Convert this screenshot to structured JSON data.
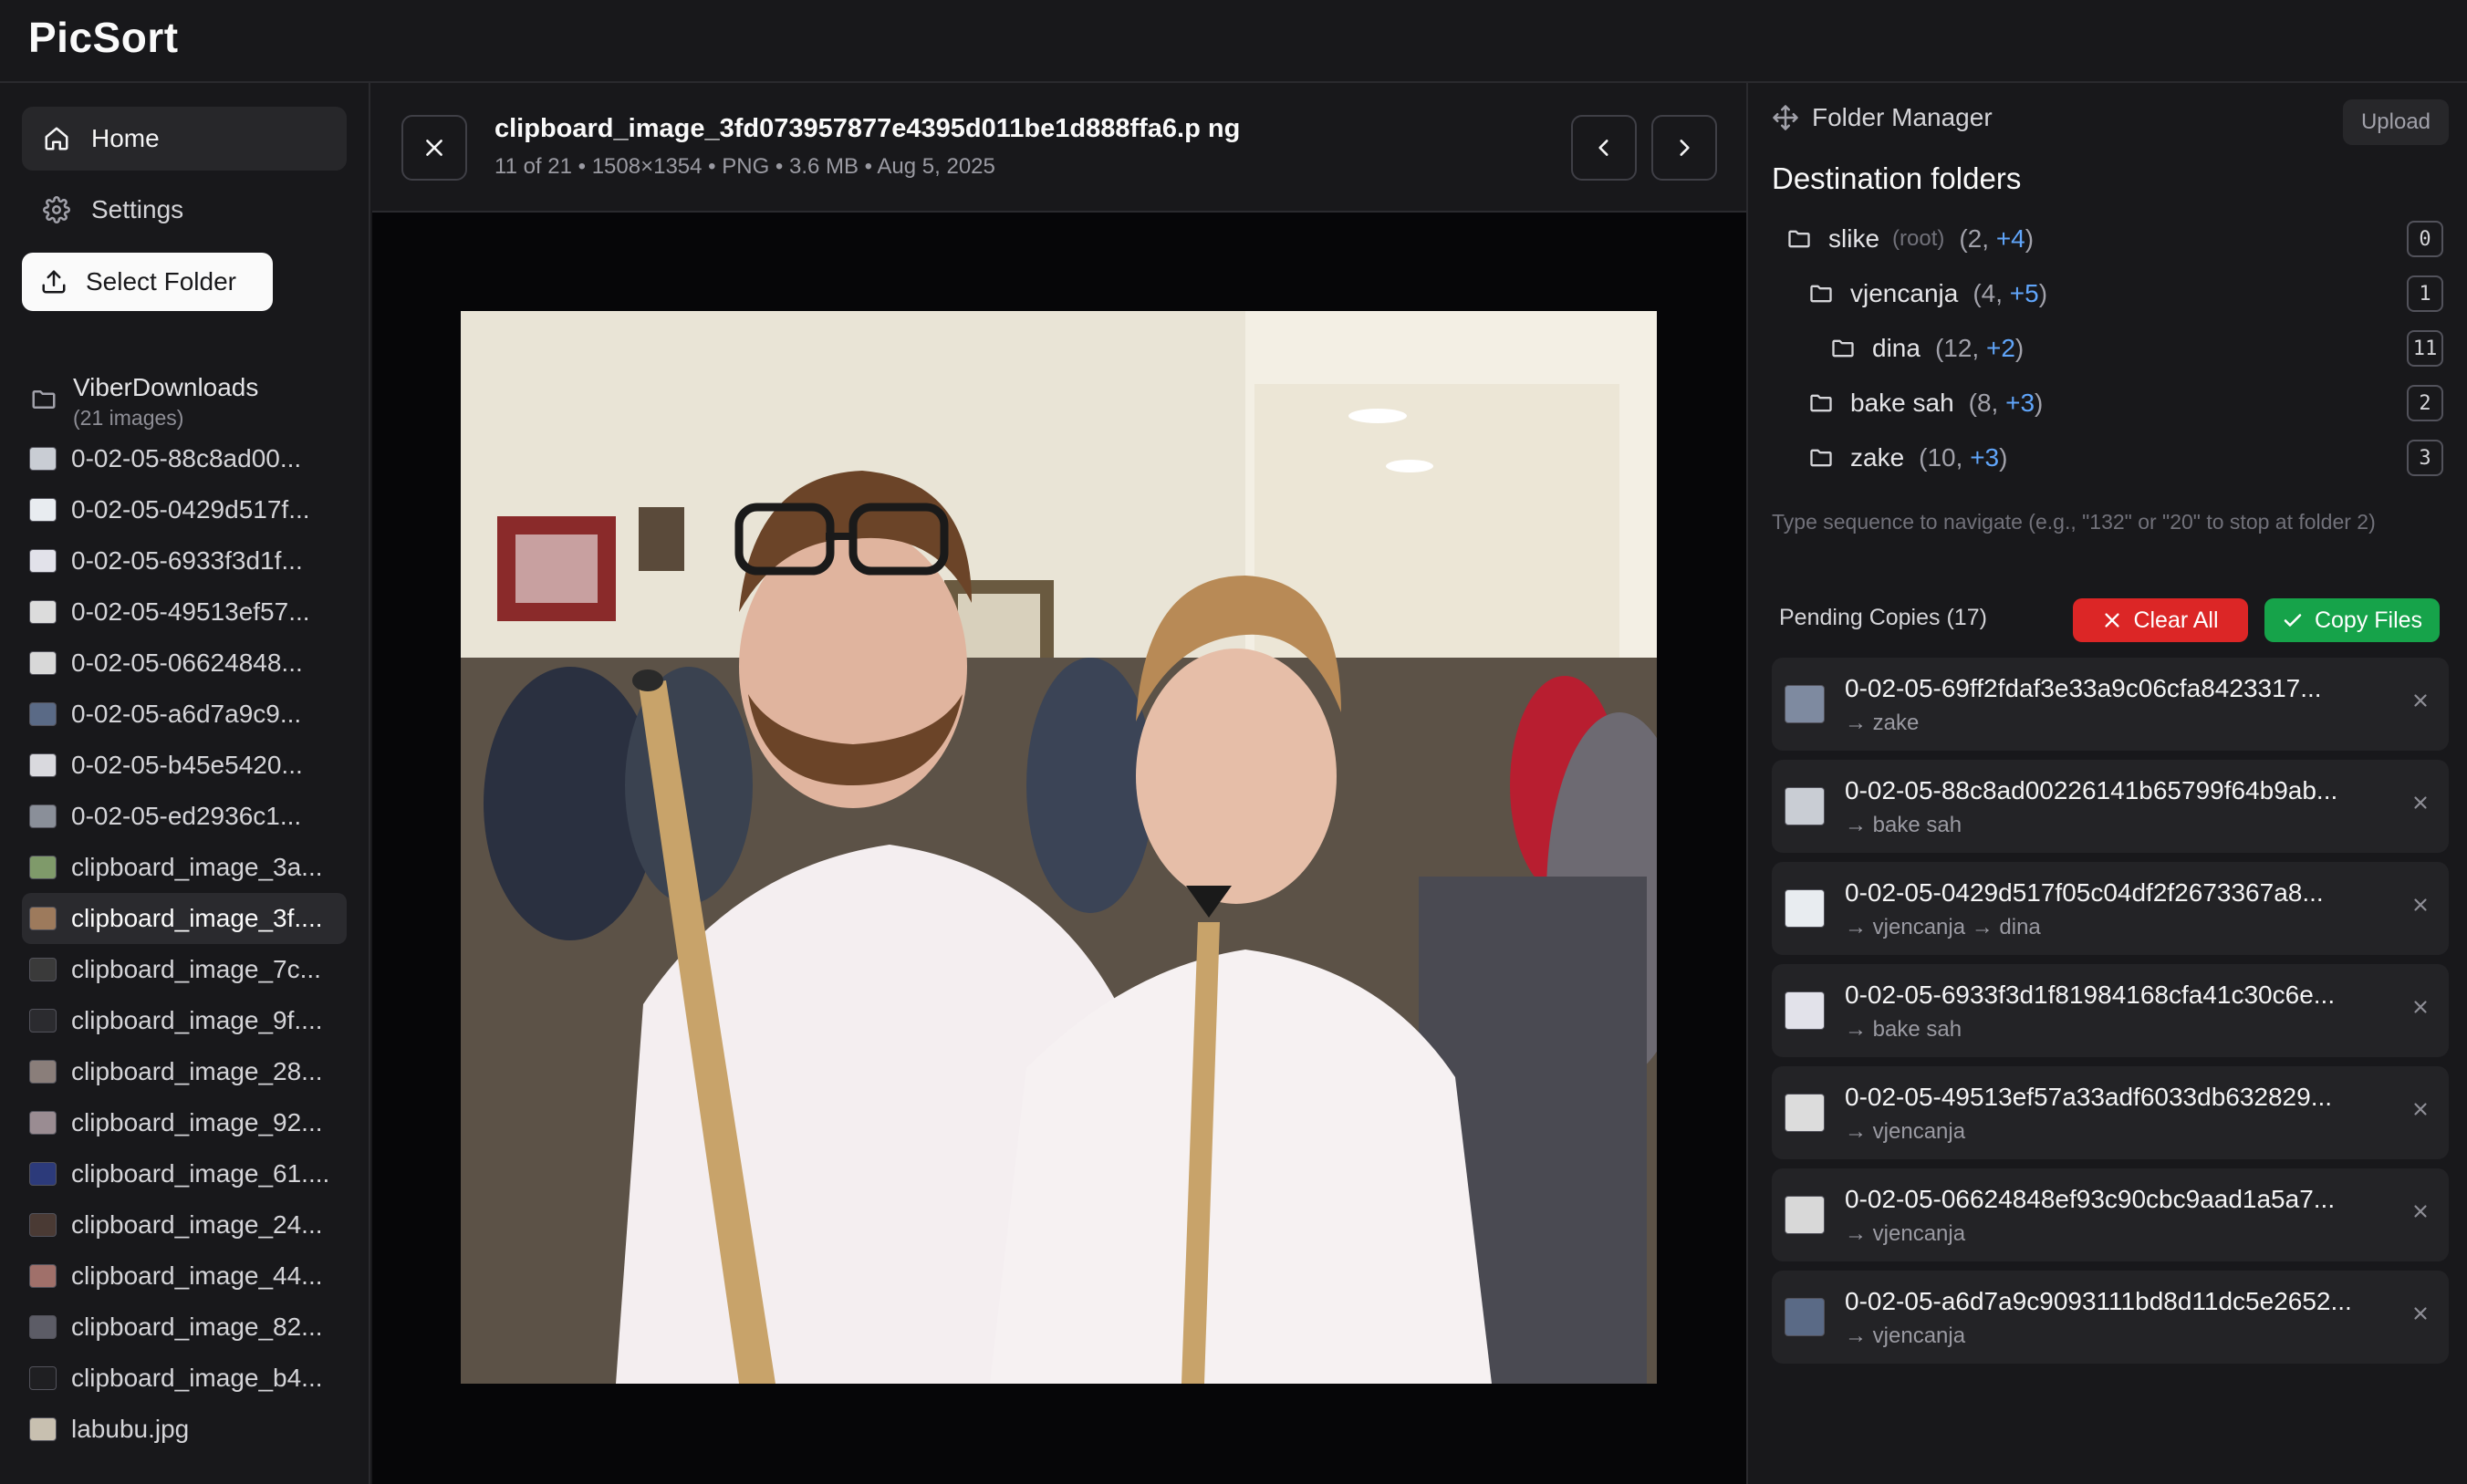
{
  "app": {
    "title": "PicSort"
  },
  "sidebar": {
    "nav": [
      {
        "label": "Home",
        "icon": "home-icon"
      },
      {
        "label": "Settings",
        "icon": "gear-icon"
      },
      {
        "label": "Select Folder",
        "icon": "upload-icon"
      }
    ],
    "folder": {
      "name": "ViberDownloads",
      "count": "(21 images)"
    },
    "files": [
      {
        "name": "0-02-05-88c8ad00...",
        "thumb": "#c9cdd4"
      },
      {
        "name": "0-02-05-0429d517f...",
        "thumb": "#e8ecf0"
      },
      {
        "name": "0-02-05-6933f3d1f...",
        "thumb": "#e2e2ea"
      },
      {
        "name": "0-02-05-49513ef57...",
        "thumb": "#dcdcdc"
      },
      {
        "name": "0-02-05-06624848...",
        "thumb": "#d8d8d8"
      },
      {
        "name": "0-02-05-a6d7a9c9...",
        "thumb": "#5a6a86"
      },
      {
        "name": "0-02-05-b45e5420...",
        "thumb": "#d9d9de"
      },
      {
        "name": "0-02-05-ed2936c1...",
        "thumb": "#8a8f99"
      },
      {
        "name": "clipboard_image_3a...",
        "thumb": "#7f9a6a"
      },
      {
        "name": "clipboard_image_3f....",
        "thumb": "#9d7a5c",
        "active": true
      },
      {
        "name": "clipboard_image_7c...",
        "thumb": "#3a3a3a"
      },
      {
        "name": "clipboard_image_9f....",
        "thumb": "#2b2b2f"
      },
      {
        "name": "clipboard_image_28...",
        "thumb": "#8a7e7a"
      },
      {
        "name": "clipboard_image_92...",
        "thumb": "#9a8c92"
      },
      {
        "name": "clipboard_image_61....",
        "thumb": "#2c3a7a"
      },
      {
        "name": "clipboard_image_24...",
        "thumb": "#4a3a34"
      },
      {
        "name": "clipboard_image_44...",
        "thumb": "#a0706a"
      },
      {
        "name": "clipboard_image_82...",
        "thumb": "#5c5c66"
      },
      {
        "name": "clipboard_image_b4...",
        "thumb": "#1f1f22"
      },
      {
        "name": "labubu.jpg",
        "thumb": "#c8c0b0"
      }
    ]
  },
  "viewer": {
    "title": "clipboard_image_3fd073957877e4395d011be1d888ffa6.p ng",
    "meta": "11 of 21 • 1508×1354 • PNG • 3.6 MB • Aug 5, 2025",
    "photo": "photo of two men in white shirts at an indoor event"
  },
  "panel": {
    "title": "Folder Manager",
    "upload_label": "Upload",
    "dest_title": "Destination folders",
    "tree": [
      {
        "name": "slike",
        "root": "(root)",
        "count": "(2, ",
        "plus": "+4",
        "close": ")",
        "key": "0"
      },
      {
        "name": "vjencanja",
        "count": "(4, ",
        "plus": "+5",
        "close": ")",
        "key": "1"
      },
      {
        "name": "dina",
        "count": "(12, ",
        "plus": "+2",
        "close": ")",
        "key": "11"
      },
      {
        "name": "bake sah",
        "count": "(8, ",
        "plus": "+3",
        "close": ")",
        "key": "2"
      },
      {
        "name": "zake",
        "count": "(10, ",
        "plus": "+3",
        "close": ")",
        "key": "3"
      }
    ],
    "hint": "Type sequence to navigate (e.g., \"132\" or \"20\" to stop at folder 2)",
    "pending_title": "Pending Copies (17)",
    "clear_label": "Clear All",
    "copy_label": "Copy Files",
    "pending": [
      {
        "name": "0-02-05-69ff2fdaf3e33a9c06cfa8423317...",
        "dest": "→ zake",
        "thumb": "#7e8aa0"
      },
      {
        "name": "0-02-05-88c8ad00226141b65799f64b9ab...",
        "dest": "→ bake sah",
        "thumb": "#c9cdd4"
      },
      {
        "name": "0-02-05-0429d517f05c04df2f2673367a8...",
        "dest": "→ vjencanja → dina",
        "thumb": "#e8ecf0"
      },
      {
        "name": "0-02-05-6933f3d1f81984168cfa41c30c6e...",
        "dest": "→ bake sah",
        "thumb": "#e2e2ea"
      },
      {
        "name": "0-02-05-49513ef57a33adf6033db632829...",
        "dest": "→ vjencanja",
        "thumb": "#dcdcdc"
      },
      {
        "name": "0-02-05-06624848ef93c90cbc9aad1a5a7...",
        "dest": "→ vjencanja",
        "thumb": "#d8d8d8"
      },
      {
        "name": "0-02-05-a6d7a9c9093111bd8d11dc5e2652...",
        "dest": "→ vjencanja",
        "thumb": "#5a6a86"
      }
    ]
  },
  "colors": {
    "accent_blue": "#60a5fa",
    "danger": "#dc2626",
    "success": "#16a34a",
    "bg": "#18181b"
  }
}
